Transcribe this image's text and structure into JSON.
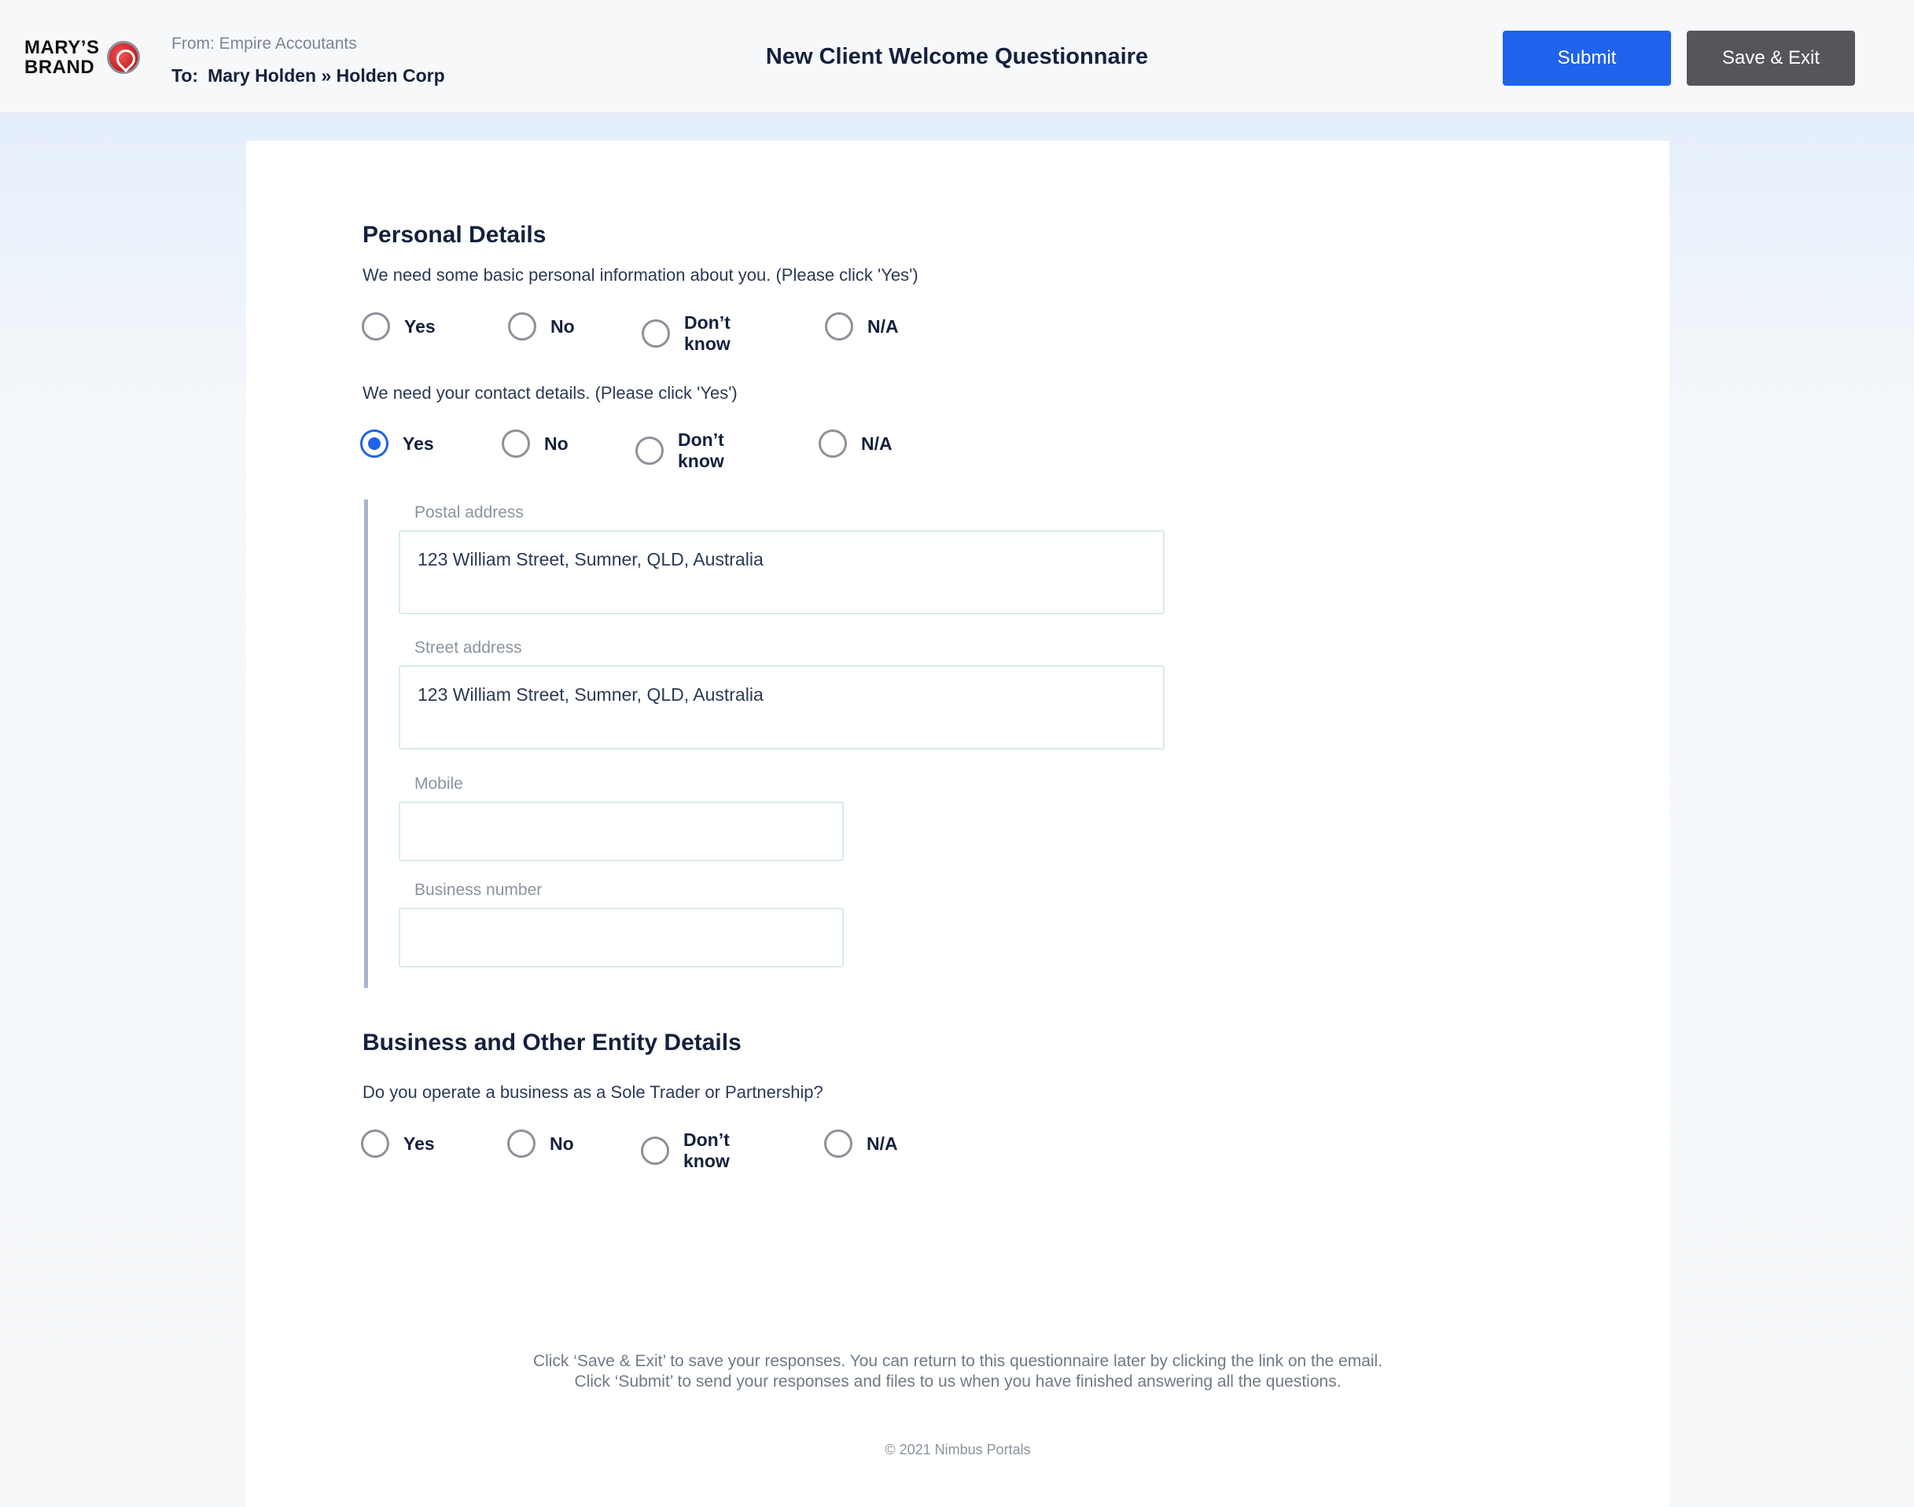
{
  "header": {
    "logo_line1": "MARY’S",
    "logo_line2": "BRAND",
    "from": "From: Empire Accoutants",
    "to_label": "To:",
    "to_value": "Mary Holden » Holden Corp",
    "title": "New Client Welcome Questionnaire",
    "submit_label": "Submit",
    "save_exit_label": "Save & Exit"
  },
  "personal": {
    "title": "Personal Details",
    "q1": "We need some basic personal information about you. (Please click 'Yes')",
    "q1_selected": "",
    "q2": "We need your contact details. (Please click 'Yes')",
    "q2_selected": "Yes"
  },
  "options": {
    "yes": "Yes",
    "no": "No",
    "dont_know": "Don’t know",
    "na": "N/A"
  },
  "contact": {
    "postal_label": "Postal address",
    "postal_value": "123 William Street, Sumner, QLD, Australia",
    "street_label": "Street address",
    "street_value": "123 William Street, Sumner, QLD, Australia",
    "mobile_label": "Mobile",
    "mobile_value": "",
    "business_number_label": "Business number",
    "business_number_value": ""
  },
  "business": {
    "title": "Business and Other Entity Details",
    "q1": "Do you operate a business as a Sole Trader or Partnership?",
    "q1_selected": ""
  },
  "footer": {
    "note_line1": "Click ‘Save & Exit’ to save your responses. You can return to this questionnaire later by clicking the link on the email.",
    "note_line2": "Click ‘Submit’ to send your responses and files to us when you have finished answering all the questions.",
    "copyright": "© 2021 Nimbus Portals"
  },
  "colors": {
    "accent": "#1f62ec",
    "secondary_button": "#54565b",
    "heading": "#14213d"
  }
}
